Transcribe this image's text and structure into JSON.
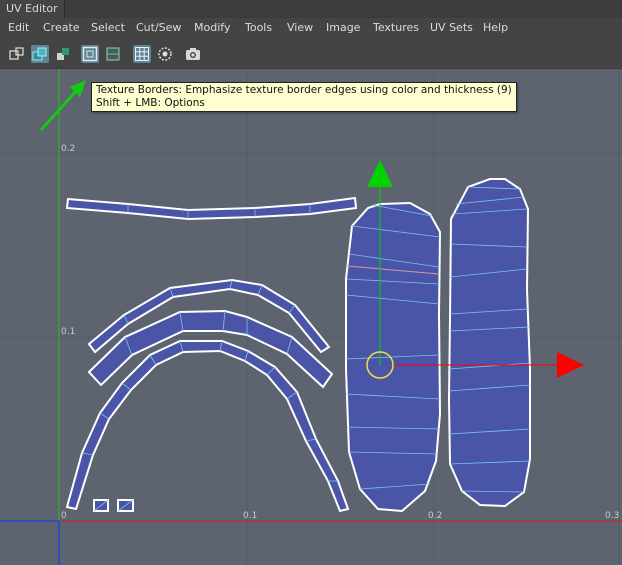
{
  "window": {
    "title": "UV Editor"
  },
  "menu": [
    "Edit",
    "Create",
    "Select",
    "Cut/Sew",
    "Modify",
    "Tools",
    "View",
    "Image",
    "Textures",
    "UV Sets",
    "Help"
  ],
  "toolbar": {
    "buttons": [
      {
        "icon": "uv-component-icon",
        "active": false
      },
      {
        "icon": "shaded-uv-icon",
        "active": true
      },
      {
        "icon": "distortion-icon",
        "active": false
      },
      {
        "icon": "texture-borders-icon",
        "active": true
      },
      {
        "icon": "uv-border-icon",
        "active": false
      },
      {
        "icon": "grid-icon",
        "active": true
      },
      {
        "icon": "pivot-icon",
        "active": false
      },
      {
        "icon": "snapshot-icon",
        "active": false
      }
    ]
  },
  "tooltip": {
    "line1": "Texture Borders: Emphasize texture border edges using color and thickness (9)",
    "line2": "Shift + LMB: Options"
  },
  "axis": {
    "y_labels": [
      "0.2",
      "0.1"
    ],
    "x_labels": [
      "0",
      "0.1",
      "0.2",
      "0.3"
    ]
  },
  "colors": {
    "uv_fill": "#4a55a8",
    "border": "#ffffff",
    "inner_edge": "#7fc4e8",
    "seam_edge": "#d49aa0",
    "y_axis": "#18c418",
    "x_axis": "#d21e1e",
    "manip_y": "#00d400",
    "manip_x": "#ff0000",
    "pivot": "#f0e040",
    "annotation_arrow": "#14c814"
  }
}
